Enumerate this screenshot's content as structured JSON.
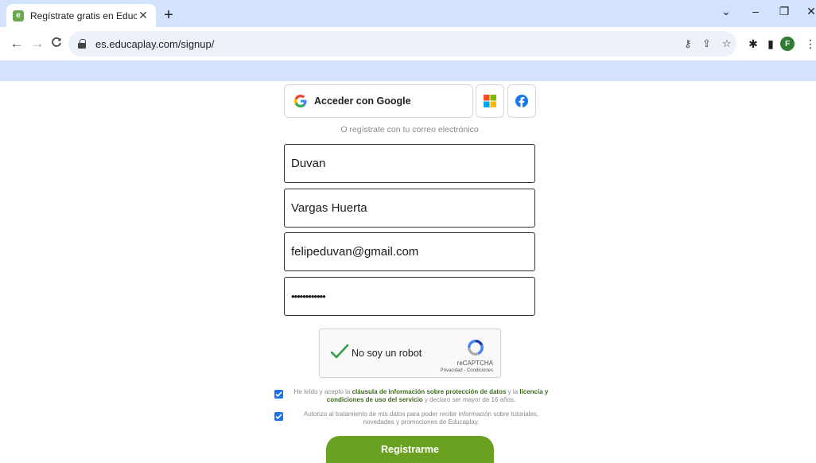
{
  "browser": {
    "tab": {
      "title": "Regístrate gratis en Educaplay",
      "favicon_letter": "e"
    },
    "url": "es.educaplay.com/signup/",
    "profile_initial": "F"
  },
  "signup": {
    "google_label": "Acceder con Google",
    "or_text": "O regístrate con tu correo electrónico",
    "first_name": "Duvan",
    "last_name": "Vargas Huerta",
    "email": "felipeduvan@gmail.com",
    "password": "••••••••••••",
    "captcha": {
      "label": "No soy un robot",
      "brand": "reCAPTCHA",
      "terms": "Privacidad - Condiciones"
    },
    "consent1": {
      "pre": "He leído y acepto la ",
      "link1": "cláusula de información sobre protección de datos",
      "mid": " y la ",
      "link2": "licencia y condiciones de uso del servicio",
      "post": " y declaro ser mayor de 16 años."
    },
    "consent2": "Autorizo al tratamiento de mis datos para poder recibir información sobre tutoriales, novedades y promociones de Educaplay.",
    "submit_label": "Registrarme"
  },
  "colors": {
    "accent_green": "#6aa121",
    "link_green": "#3f6b1e",
    "checkbox_blue": "#1a73e8",
    "chrome_blue": "#d3e3fd"
  }
}
